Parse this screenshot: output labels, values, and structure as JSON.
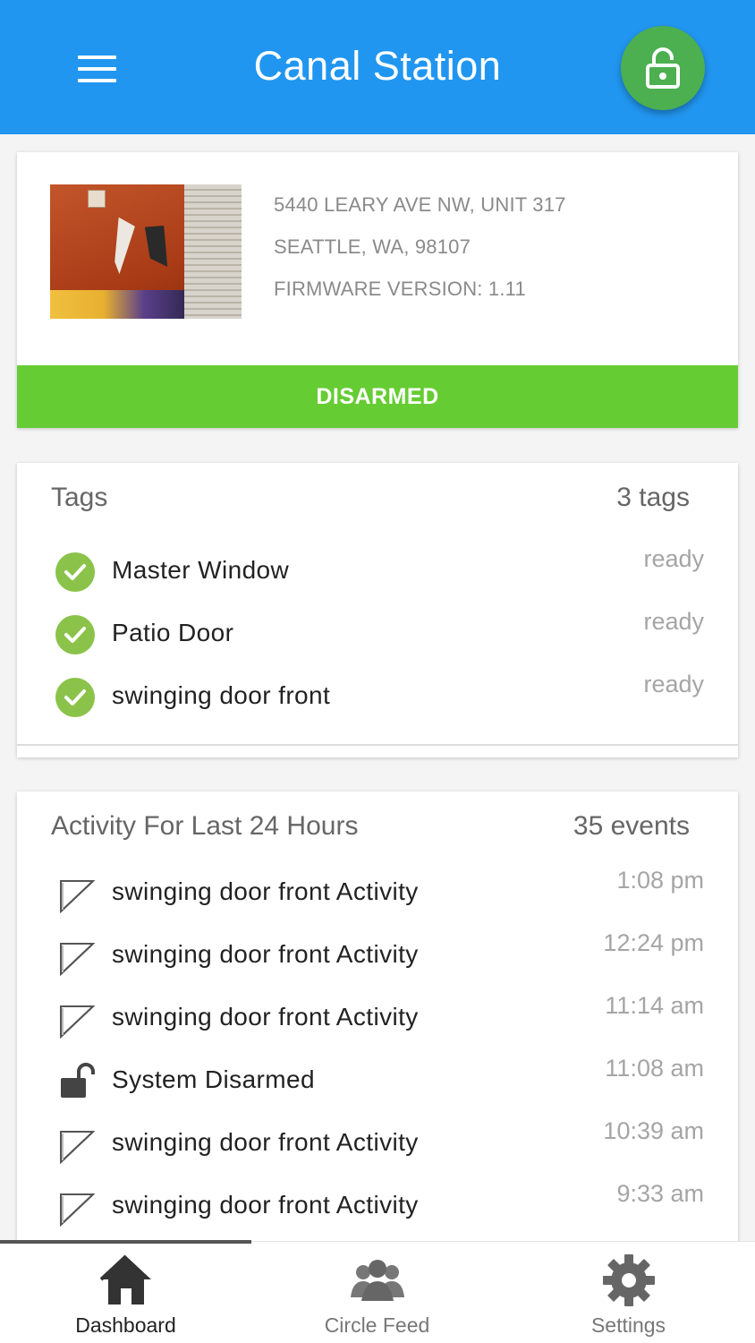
{
  "app_bar": {
    "title": "Canal Station",
    "menu_icon": "hamburger-menu-icon",
    "lock_icon": "unlocked-padlock-icon",
    "color": "#2196f0",
    "fab_color": "#4caf50"
  },
  "station": {
    "address_line1": "5440 LEARY AVE NW, UNIT 317",
    "address_line2": "SEATTLE,  WA,  98107",
    "firmware": "FIRMWARE VERSION: 1.11",
    "status": "DISARMED",
    "status_color": "#66cc33"
  },
  "tags": {
    "title": "Tags",
    "count": "3 tags",
    "items": [
      {
        "label": "Master Window",
        "status": "ready"
      },
      {
        "label": "Patio Door",
        "status": "ready"
      },
      {
        "label": "swinging door front",
        "status": "ready"
      }
    ]
  },
  "activity": {
    "title": "Activity For Last 24 Hours",
    "count": "35 events",
    "items": [
      {
        "label": "swinging door front Activity",
        "time": "1:08 pm",
        "icon": "door-activity-icon"
      },
      {
        "label": "swinging door front Activity",
        "time": "12:24 pm",
        "icon": "door-activity-icon"
      },
      {
        "label": "swinging door front Activity",
        "time": "11:14 am",
        "icon": "door-activity-icon"
      },
      {
        "label": "System Disarmed",
        "time": "11:08 am",
        "icon": "unlocked-padlock-icon"
      },
      {
        "label": "swinging door front Activity",
        "time": "10:39 am",
        "icon": "door-activity-icon"
      },
      {
        "label": "swinging door front Activity",
        "time": "9:33 am",
        "icon": "door-activity-icon"
      }
    ]
  },
  "bottom_nav": {
    "items": [
      {
        "label": "Dashboard",
        "icon": "home-icon",
        "active": true
      },
      {
        "label": "Circle Feed",
        "icon": "group-icon",
        "active": false
      },
      {
        "label": "Settings",
        "icon": "gear-icon",
        "active": false
      }
    ]
  }
}
